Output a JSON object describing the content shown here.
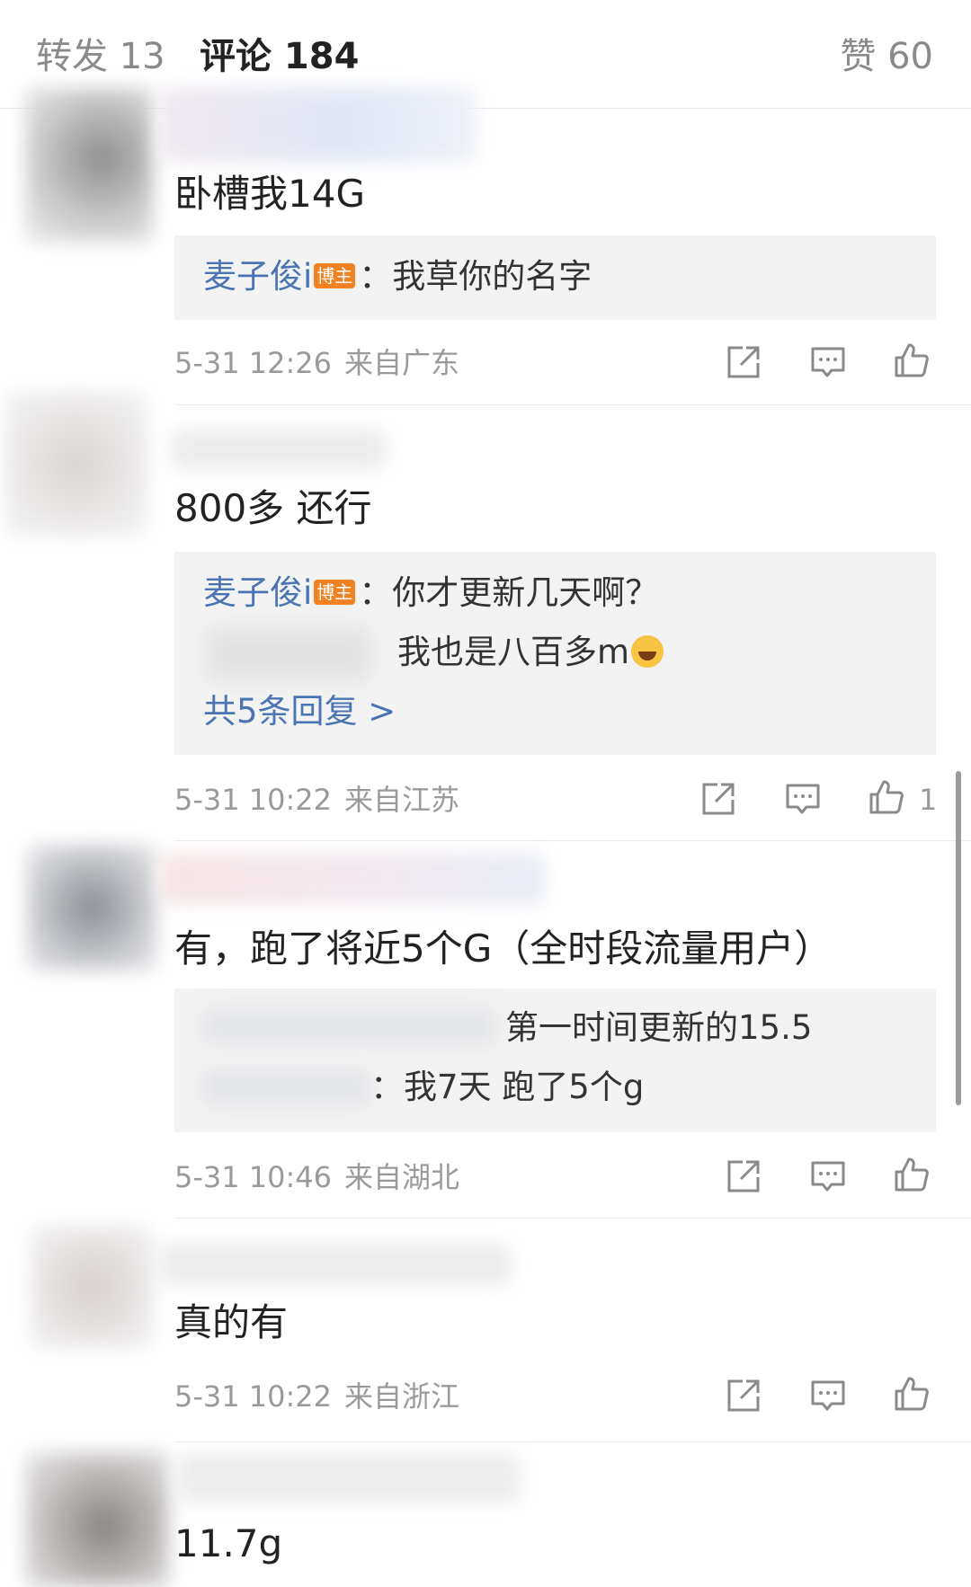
{
  "tabs": {
    "repost": "转发 13",
    "comments": "评论 184",
    "likes": "赞 60"
  },
  "comments": [
    {
      "text": "卧槽我14G",
      "reply": {
        "name": "麦子俊i",
        "badge": "博主",
        "text": "：我草你的名字"
      },
      "time": "5-31 12:26",
      "location": "来自广东",
      "like_count": ""
    },
    {
      "text": "800多 还行",
      "reply": {
        "name": "麦子俊i",
        "badge": "博主",
        "text": "：你才更新几天啊？",
        "line2": "我也是八百多m",
        "more": "共5条回复 >"
      },
      "time": "5-31 10:22",
      "location": "来自江苏",
      "like_count": "1"
    },
    {
      "text": "有，跑了将近5个G（全时段流量用户）",
      "reply": {
        "line1": "第一时间更新的15.5",
        "line2": "：我7天 跑了5个g"
      },
      "time": "5-31 10:46",
      "location": "来自湖北",
      "like_count": ""
    },
    {
      "text": "真的有",
      "time": "5-31 10:22",
      "location": "来自浙江",
      "like_count": ""
    },
    {
      "text": "11.7g"
    }
  ],
  "colors": {
    "link": "#4b74b2",
    "badge": "#f08222",
    "meta": "#9a9a9a",
    "reply_bg": "#f3f3f3"
  },
  "icons": [
    "share-icon",
    "comment-icon",
    "like-icon",
    "laugh-cry-emoji"
  ]
}
